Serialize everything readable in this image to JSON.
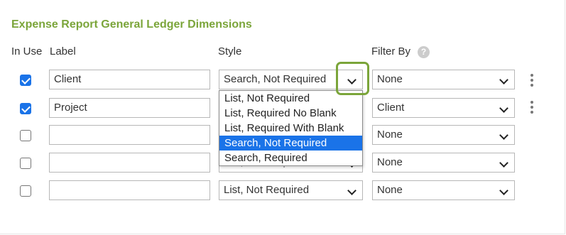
{
  "section": {
    "title": "Expense Report General Ledger Dimensions"
  },
  "headers": {
    "in_use": "In Use",
    "label": "Label",
    "style": "Style",
    "filter_by": "Filter By",
    "help": "?"
  },
  "rows": [
    {
      "in_use": true,
      "label": "Client",
      "style": "Search, Not Required",
      "filter_by": "None"
    },
    {
      "in_use": true,
      "label": "Project",
      "style": "",
      "filter_by": "Client"
    },
    {
      "in_use": false,
      "label": "",
      "style": "",
      "filter_by": "None"
    },
    {
      "in_use": false,
      "label": "",
      "style": "List, Not Required",
      "filter_by": "None"
    },
    {
      "in_use": false,
      "label": "",
      "style": "List, Not Required",
      "filter_by": "None"
    }
  ],
  "style_dropdown": {
    "options": [
      "List, Not Required",
      "List, Required No Blank",
      "List, Required With Blank",
      "Search, Not Required",
      "Search, Required"
    ],
    "selected_option": "Search, Not Required"
  },
  "colors": {
    "accent": "#7ba53a",
    "selection": "#1a73e8",
    "checkbox": "#1a73e8"
  },
  "icons": {
    "help": "question-circle-icon",
    "menu": "kebab-menu-icon",
    "dropdown": "chevron-down-icon"
  }
}
